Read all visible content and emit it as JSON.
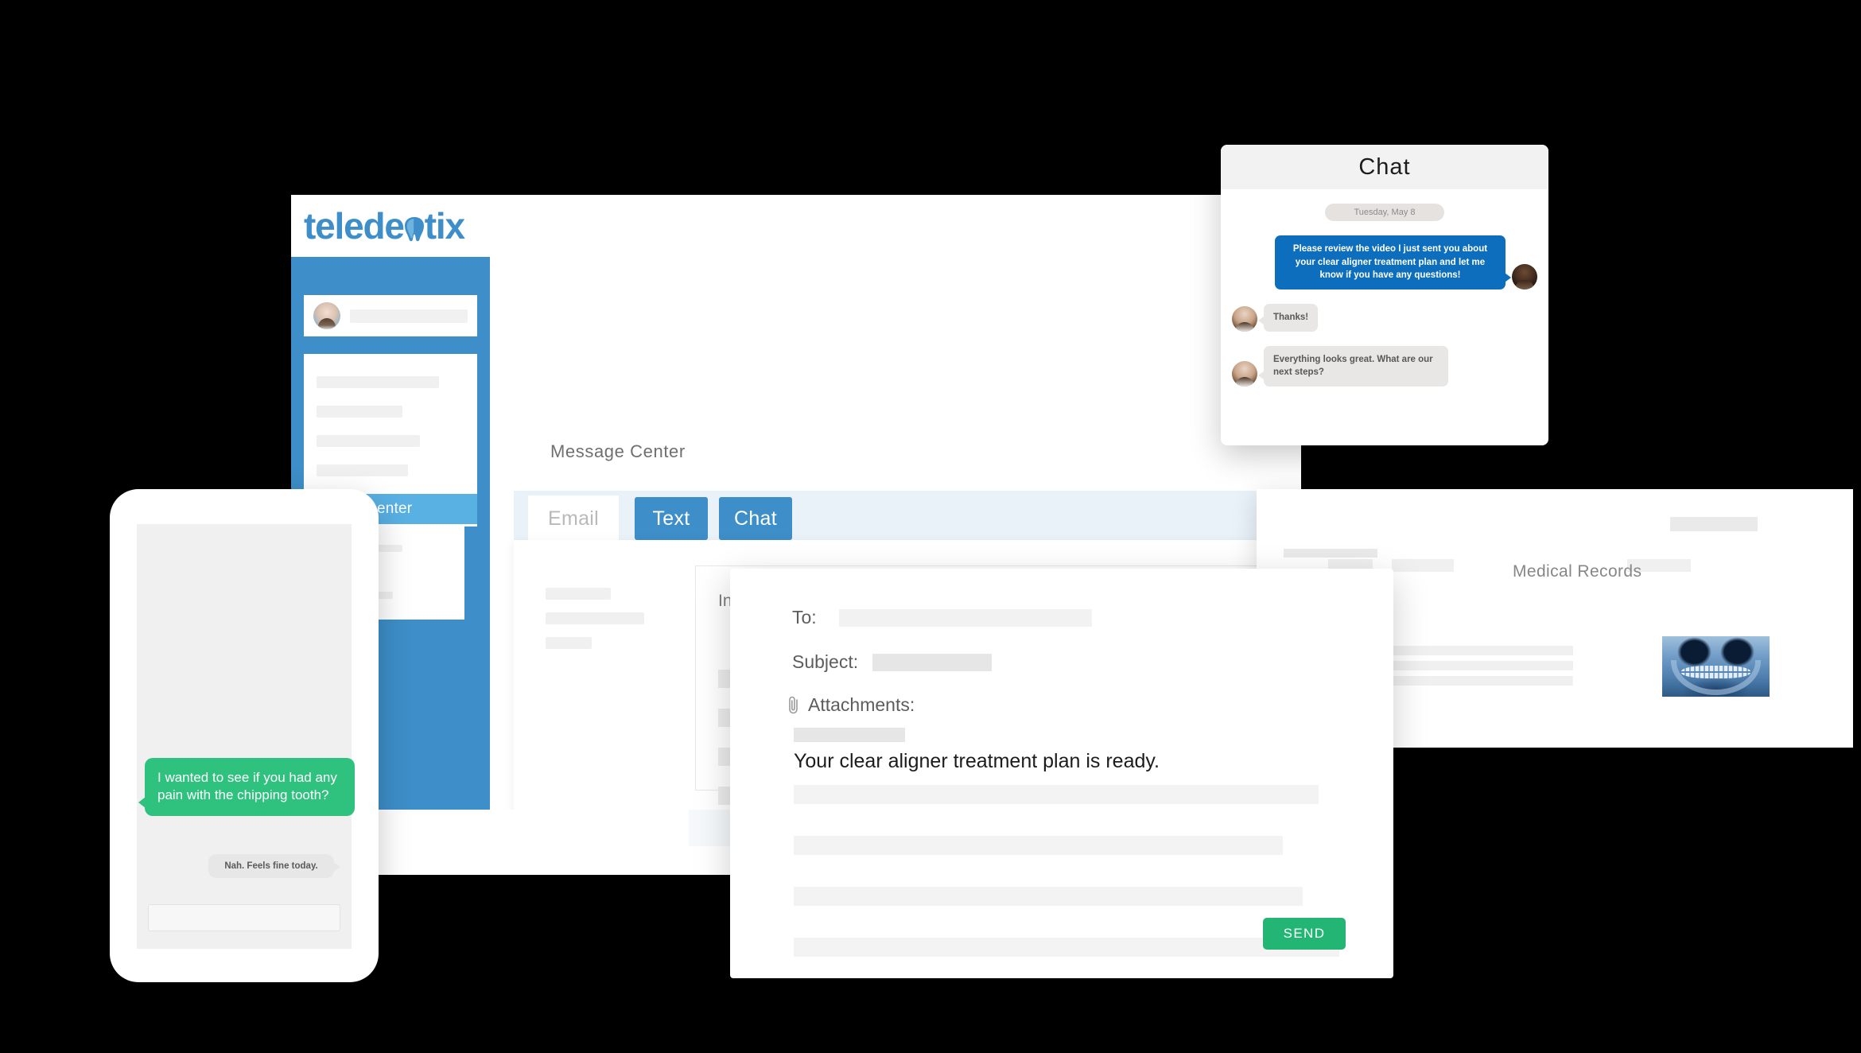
{
  "brand": {
    "logo_part1": "teled",
    "logo_part2": "e",
    "logo_icon": "tooth-icon",
    "logo_part3": "tix",
    "color_primary": "#3d8ec9",
    "color_accent_blue": "#0d6ebd",
    "color_send_green": "#22b573",
    "color_sms_green": "#2ec27e",
    "color_sidebar_active": "#58b0e3"
  },
  "app": {
    "page_title": "Message Center",
    "sidebar": {
      "active_item": "enter",
      "user_name_placeholder": "",
      "avatar": "user-avatar"
    },
    "tabs": [
      {
        "label": "Email",
        "active": true
      },
      {
        "label": "Text",
        "active": false
      },
      {
        "label": "Chat",
        "active": false
      }
    ],
    "inbox": {
      "label": "Inbox",
      "search_placeholder": "",
      "rows": [
        {
          "col1": "",
          "col2": ""
        },
        {
          "col1": "",
          "col2": ""
        },
        {
          "col1": "",
          "col2": ""
        },
        {
          "col1": "",
          "col2": ""
        }
      ]
    }
  },
  "chat_panel": {
    "title": "Chat",
    "date_divider": "Tuesday, May 8",
    "messages": [
      {
        "direction": "out",
        "text": "Please review the video I just sent you about your clear aligner treatment plan and let me know if you have any questions!",
        "avatar": "provider-avatar"
      },
      {
        "direction": "in",
        "text": "Thanks!",
        "avatar": "patient-avatar"
      },
      {
        "direction": "in",
        "text": "Everything looks great. What are our next steps?",
        "avatar": "patient-avatar"
      }
    ]
  },
  "records_panel": {
    "title": "Medical Records",
    "xray_label": "dental-xray-image"
  },
  "compose": {
    "to_label": "To:",
    "to_value": "",
    "subject_label": "Subject:",
    "subject_value": "",
    "attachments_label": "Attachments:",
    "attachment_icon": "paperclip-icon",
    "attachment_value": "",
    "headline": "Your clear aligner treatment plan is ready.",
    "send_label": "SEND"
  },
  "phone": {
    "outgoing_message": "I wanted to see if you had any pain with the chipping tooth?",
    "incoming_message": "Nah. Feels fine today.",
    "input_placeholder": ""
  }
}
